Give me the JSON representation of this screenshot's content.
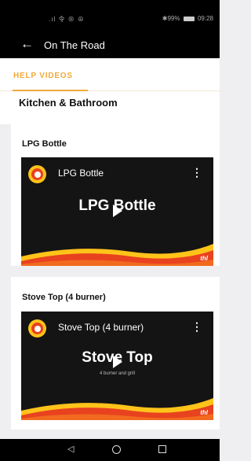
{
  "status": {
    "signal_icons": ".ıl 令 ⊗ ⊕",
    "bluetooth_battery": "✱99%",
    "time": "09:28"
  },
  "appbar": {
    "title": "On The Road"
  },
  "tabs": [
    {
      "label": "HELP VIDEOS"
    }
  ],
  "section": {
    "title": "Kitchen & Bathroom"
  },
  "videos": [
    {
      "card_title": "LPG Bottle",
      "video_title": "LPG Bottle",
      "headline": "LPG Bottle",
      "subtitle": "",
      "brand": "thl"
    },
    {
      "card_title": "Stove Top (4 burner)",
      "video_title": "Stove Top (4 burner)",
      "headline": "Stove Top",
      "subtitle": "4 burner and grill",
      "brand": "thl"
    }
  ],
  "colors": {
    "accent": "#f2a93b",
    "wave_red": "#e8421f",
    "wave_yellow": "#ffc31a",
    "video_bg": "#141414"
  }
}
